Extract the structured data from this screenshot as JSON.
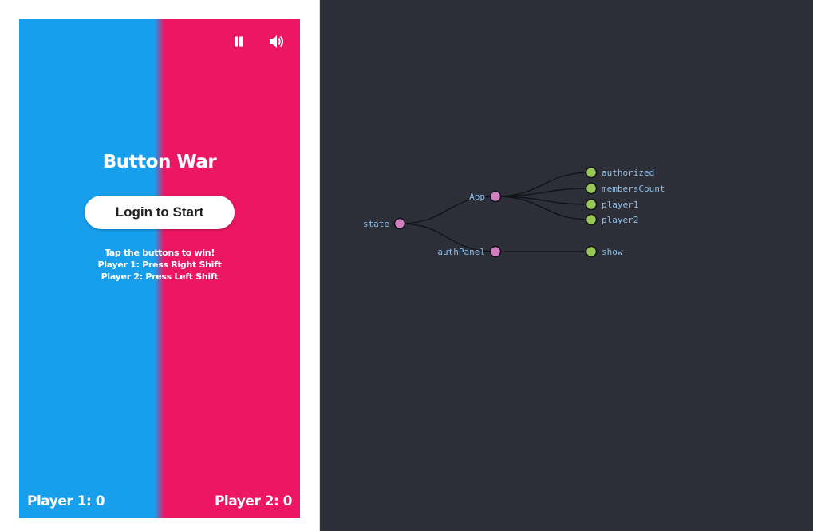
{
  "colors": {
    "player1": "#179fec",
    "player2": "#ec1662",
    "panel_bg": "#2c2f38",
    "branch_node": "#d07ec0",
    "leaf_node": "#98c758",
    "link": "#0f1116",
    "label": "#8fbfe8"
  },
  "game": {
    "title": "Button War",
    "login_button": "Login to Start",
    "instructions": [
      "Tap the buttons to win!",
      "Player 1: Press Right Shift",
      "Player 2: Press Left Shift"
    ],
    "score_p1": "Player 1: 0",
    "score_p2": "Player 2: 0",
    "pause_icon": "pause-icon",
    "sound_icon": "speaker-icon"
  },
  "state_tree": {
    "root": "state",
    "children": [
      {
        "name": "App",
        "children": [
          "authorized",
          "membersCount",
          "player1",
          "player2"
        ]
      },
      {
        "name": "authPanel",
        "children": [
          "show"
        ]
      }
    ]
  }
}
